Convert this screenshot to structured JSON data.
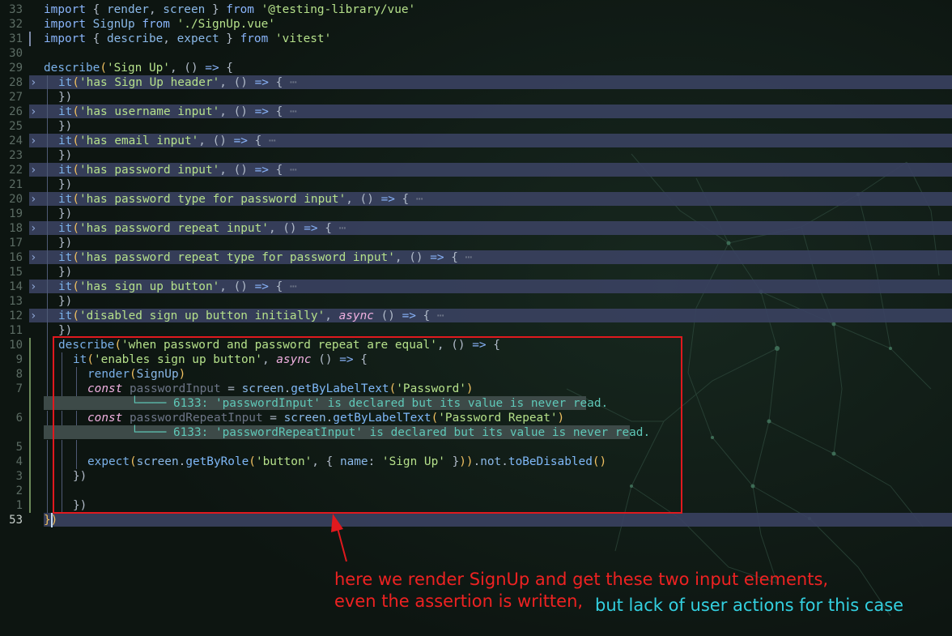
{
  "editor": {
    "lines": [
      {
        "num": "33",
        "indent": 0,
        "tokens": [
          [
            "k",
            "import"
          ],
          [
            "p",
            " { "
          ],
          [
            "id",
            "render"
          ],
          [
            "p",
            ", "
          ],
          [
            "id",
            "screen"
          ],
          [
            "p",
            " } "
          ],
          [
            "k",
            "from"
          ],
          [
            "p",
            " "
          ],
          [
            "s",
            "'@testing-library/vue'"
          ]
        ]
      },
      {
        "num": "32",
        "indent": 0,
        "tokens": [
          [
            "k",
            "import"
          ],
          [
            "p",
            " "
          ],
          [
            "id",
            "SignUp"
          ],
          [
            "p",
            " "
          ],
          [
            "k",
            "from"
          ],
          [
            "p",
            " "
          ],
          [
            "s",
            "'./SignUp.vue'"
          ]
        ]
      },
      {
        "num": "31",
        "indent": 0,
        "mod": true,
        "tokens": [
          [
            "k",
            "import"
          ],
          [
            "p",
            " { "
          ],
          [
            "id",
            "describe"
          ],
          [
            "p",
            ", "
          ],
          [
            "id",
            "expect"
          ],
          [
            "p",
            " } "
          ],
          [
            "k",
            "from"
          ],
          [
            "p",
            " "
          ],
          [
            "s",
            "'vitest'"
          ]
        ]
      },
      {
        "num": "30",
        "indent": 0,
        "tokens": []
      },
      {
        "num": "29",
        "indent": 0,
        "tokens": [
          [
            "fn",
            "describe"
          ],
          [
            "br",
            "("
          ],
          [
            "s",
            "'Sign Up'"
          ],
          [
            "p",
            ", "
          ],
          [
            "p",
            "() "
          ],
          [
            "k",
            "=>"
          ],
          [
            "p",
            " {"
          ]
        ]
      },
      {
        "num": "28",
        "indent": 1,
        "folded": true,
        "tokens": [
          [
            "fn",
            "it"
          ],
          [
            "br",
            "("
          ],
          [
            "s",
            "'has Sign Up header'"
          ],
          [
            "p",
            ", () "
          ],
          [
            "k",
            "=>"
          ],
          [
            "p",
            " { "
          ],
          [
            "dim",
            "⋯"
          ]
        ]
      },
      {
        "num": "27",
        "indent": 1,
        "tokens": [
          [
            "p",
            "})"
          ]
        ]
      },
      {
        "num": "26",
        "indent": 1,
        "folded": true,
        "tokens": [
          [
            "fn",
            "it"
          ],
          [
            "br",
            "("
          ],
          [
            "s",
            "'has username input'"
          ],
          [
            "p",
            ", () "
          ],
          [
            "k",
            "=>"
          ],
          [
            "p",
            " { "
          ],
          [
            "dim",
            "⋯"
          ]
        ]
      },
      {
        "num": "25",
        "indent": 1,
        "tokens": [
          [
            "p",
            "})"
          ]
        ]
      },
      {
        "num": "24",
        "indent": 1,
        "folded": true,
        "tokens": [
          [
            "fn",
            "it"
          ],
          [
            "br",
            "("
          ],
          [
            "s",
            "'has email input'"
          ],
          [
            "p",
            ", () "
          ],
          [
            "k",
            "=>"
          ],
          [
            "p",
            " { "
          ],
          [
            "dim",
            "⋯"
          ]
        ]
      },
      {
        "num": "23",
        "indent": 1,
        "tokens": [
          [
            "p",
            "})"
          ]
        ]
      },
      {
        "num": "22",
        "indent": 1,
        "folded": true,
        "tokens": [
          [
            "fn",
            "it"
          ],
          [
            "br",
            "("
          ],
          [
            "s",
            "'has password input'"
          ],
          [
            "p",
            ", () "
          ],
          [
            "k",
            "=>"
          ],
          [
            "p",
            " { "
          ],
          [
            "dim",
            "⋯"
          ]
        ]
      },
      {
        "num": "21",
        "indent": 1,
        "tokens": [
          [
            "p",
            "})"
          ]
        ]
      },
      {
        "num": "20",
        "indent": 1,
        "folded": true,
        "tokens": [
          [
            "fn",
            "it"
          ],
          [
            "br",
            "("
          ],
          [
            "s",
            "'has password type for password input'"
          ],
          [
            "p",
            ", () "
          ],
          [
            "k",
            "=>"
          ],
          [
            "p",
            " { "
          ],
          [
            "dim",
            "⋯"
          ]
        ]
      },
      {
        "num": "19",
        "indent": 1,
        "tokens": [
          [
            "p",
            "})"
          ]
        ]
      },
      {
        "num": "18",
        "indent": 1,
        "folded": true,
        "tokens": [
          [
            "fn",
            "it"
          ],
          [
            "br",
            "("
          ],
          [
            "s",
            "'has password repeat input'"
          ],
          [
            "p",
            ", () "
          ],
          [
            "k",
            "=>"
          ],
          [
            "p",
            " { "
          ],
          [
            "dim",
            "⋯"
          ]
        ]
      },
      {
        "num": "17",
        "indent": 1,
        "tokens": [
          [
            "p",
            "})"
          ]
        ]
      },
      {
        "num": "16",
        "indent": 1,
        "folded": true,
        "tokens": [
          [
            "fn",
            "it"
          ],
          [
            "br",
            "("
          ],
          [
            "s",
            "'has password repeat type for password input'"
          ],
          [
            "p",
            ", () "
          ],
          [
            "k",
            "=>"
          ],
          [
            "p",
            " { "
          ],
          [
            "dim",
            "⋯"
          ]
        ]
      },
      {
        "num": "15",
        "indent": 1,
        "tokens": [
          [
            "p",
            "})"
          ]
        ]
      },
      {
        "num": "14",
        "indent": 1,
        "folded": true,
        "tokens": [
          [
            "fn",
            "it"
          ],
          [
            "br",
            "("
          ],
          [
            "s",
            "'has sign up button'"
          ],
          [
            "p",
            ", () "
          ],
          [
            "k",
            "=>"
          ],
          [
            "p",
            " { "
          ],
          [
            "dim",
            "⋯"
          ]
        ]
      },
      {
        "num": "13",
        "indent": 1,
        "tokens": [
          [
            "p",
            "})"
          ]
        ]
      },
      {
        "num": "12",
        "indent": 1,
        "folded": true,
        "tokens": [
          [
            "fn",
            "it"
          ],
          [
            "br",
            "("
          ],
          [
            "s",
            "'disabled sign up button initially'"
          ],
          [
            "p",
            ", "
          ],
          [
            "it",
            "async"
          ],
          [
            "p",
            " () "
          ],
          [
            "k",
            "=>"
          ],
          [
            "p",
            " { "
          ],
          [
            "dim",
            "⋯"
          ]
        ]
      },
      {
        "num": "11",
        "indent": 1,
        "tokens": [
          [
            "p",
            "})"
          ]
        ]
      },
      {
        "num": "10",
        "indent": 1,
        "modgreen": true,
        "tokens": [
          [
            "fn",
            "describe"
          ],
          [
            "br",
            "("
          ],
          [
            "s",
            "'when password and password repeat are equal'"
          ],
          [
            "p",
            ", () "
          ],
          [
            "k",
            "=>"
          ],
          [
            "p",
            " {"
          ]
        ]
      },
      {
        "num": "9",
        "indent": 2,
        "modgreen": true,
        "tokens": [
          [
            "fn",
            "it"
          ],
          [
            "br",
            "("
          ],
          [
            "s",
            "'enables sign up button'"
          ],
          [
            "p",
            ", "
          ],
          [
            "it",
            "async"
          ],
          [
            "p",
            " () "
          ],
          [
            "k",
            "=>"
          ],
          [
            "p",
            " {"
          ]
        ]
      },
      {
        "num": "8",
        "indent": 3,
        "modgreen": true,
        "tokens": [
          [
            "fn",
            "render"
          ],
          [
            "br",
            "("
          ],
          [
            "id",
            "SignUp"
          ],
          [
            "br",
            ")"
          ]
        ]
      },
      {
        "num": "7",
        "indent": 3,
        "modgreen": true,
        "tokens": [
          [
            "it",
            "const"
          ],
          [
            "p",
            " "
          ],
          [
            "dim",
            "passwordInput"
          ],
          [
            "p",
            " = "
          ],
          [
            "id",
            "screen"
          ],
          [
            "p",
            "."
          ],
          [
            "mth",
            "getByLabelText"
          ],
          [
            "br",
            "("
          ],
          [
            "s",
            "'Password'"
          ],
          [
            "br",
            ")"
          ]
        ]
      },
      {
        "num": "",
        "indent": 0,
        "modgreen": true,
        "virtual": true,
        "vcol": 6,
        "vtext": "└──── 6133: 'passwordInput' is declared but its value is never read."
      },
      {
        "num": "6",
        "indent": 3,
        "modgreen": true,
        "tokens": [
          [
            "it",
            "const"
          ],
          [
            "p",
            " "
          ],
          [
            "dim",
            "passwordRepeatInput"
          ],
          [
            "p",
            " = "
          ],
          [
            "id",
            "screen"
          ],
          [
            "p",
            "."
          ],
          [
            "mth",
            "getByLabelText"
          ],
          [
            "br",
            "("
          ],
          [
            "s",
            "'Password Repeat'"
          ],
          [
            "br",
            ")"
          ]
        ]
      },
      {
        "num": "",
        "indent": 0,
        "modgreen": true,
        "virtual": true,
        "vcol": 6,
        "vtext": "└──── 6133: 'passwordRepeatInput' is declared but its value is never read."
      },
      {
        "num": "5",
        "indent": 3,
        "modgreen": true,
        "tokens": []
      },
      {
        "num": "4",
        "indent": 3,
        "modgreen": true,
        "tokens": [
          [
            "fn",
            "expect"
          ],
          [
            "br",
            "("
          ],
          [
            "id",
            "screen"
          ],
          [
            "p",
            "."
          ],
          [
            "mth",
            "getByRole"
          ],
          [
            "br",
            "("
          ],
          [
            "s",
            "'button'"
          ],
          [
            "p",
            ", { "
          ],
          [
            "id",
            "name"
          ],
          [
            "p",
            ": "
          ],
          [
            "s",
            "'Sign Up'"
          ],
          [
            "p",
            " }"
          ],
          [
            "br",
            "))"
          ],
          [
            "p",
            "."
          ],
          [
            "id",
            "not"
          ],
          [
            "p",
            "."
          ],
          [
            "mth",
            "toBeDisabled"
          ],
          [
            "br",
            "()"
          ]
        ]
      },
      {
        "num": "3",
        "indent": 2,
        "modgreen": true,
        "tokens": [
          [
            "p",
            "})"
          ]
        ]
      },
      {
        "num": "2",
        "indent": 2,
        "modgreen": true,
        "tokens": []
      },
      {
        "num": "1",
        "indent": 2,
        "modgreen": true,
        "tokens": [
          [
            "p",
            "})"
          ]
        ]
      },
      {
        "num": "53",
        "indent": 0,
        "current": true,
        "last": true,
        "tokens": [
          [
            "br",
            "}"
          ],
          [
            "br",
            ")"
          ]
        ]
      }
    ]
  },
  "annotation": {
    "line1": "here we render SignUp and get these two input elements,",
    "line2": "even the assertion is written,",
    "line3": "but lack of user actions for this case",
    "box_color": "#e0191e",
    "note_color": "#ee2222",
    "accent_color": "#33d0e0"
  },
  "colors": {
    "background": "#0d1511",
    "fold_highlight": "#3a4160",
    "string": "#b5e08a",
    "keyword": "#89b4fa"
  }
}
